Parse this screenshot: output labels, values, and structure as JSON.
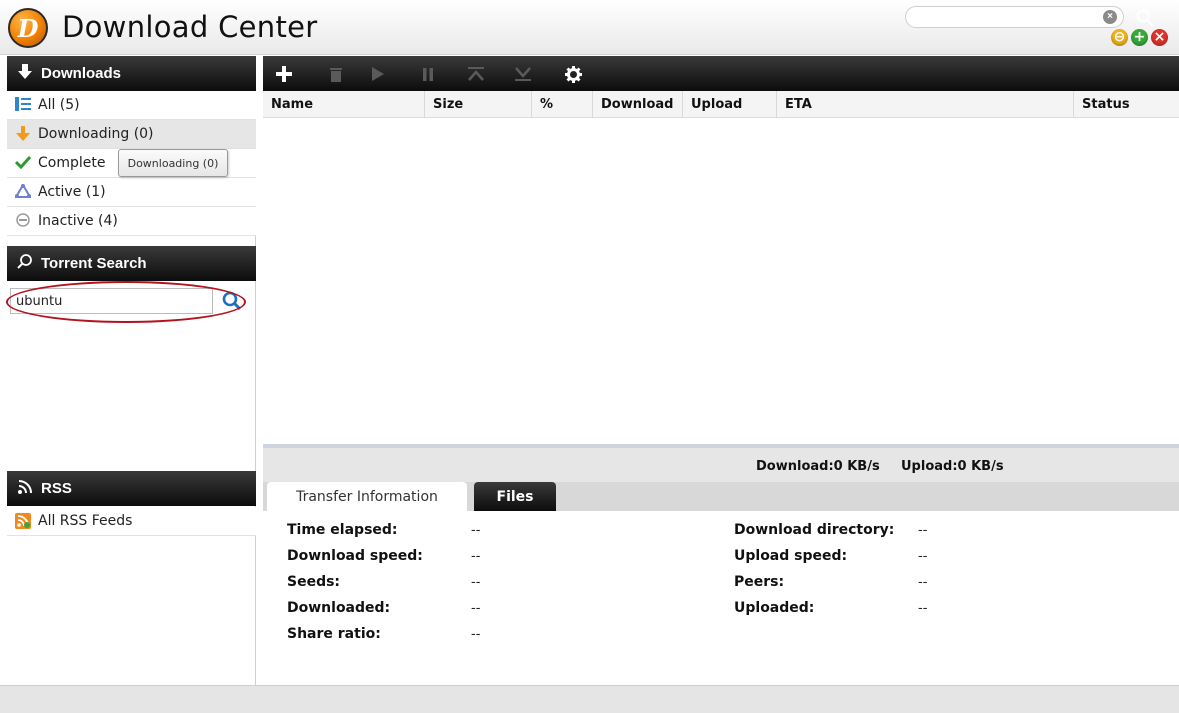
{
  "app": {
    "logo_letter": "D",
    "title": "Download Center"
  },
  "window_controls": {
    "minimize": "⊖",
    "maximize": "+",
    "close": "×"
  },
  "sidebar": {
    "downloads_header": "Downloads",
    "filters": [
      {
        "label": "All (5)",
        "icon": "list-icon"
      },
      {
        "label": "Downloading (0)",
        "icon": "download-arrow-icon"
      },
      {
        "label": "Complete",
        "icon": "checkmark-icon"
      },
      {
        "label": "Active (1)",
        "icon": "active-icon"
      },
      {
        "label": "Inactive (4)",
        "icon": "inactive-icon"
      }
    ],
    "tooltip": "Downloading (0)",
    "search_header": "Torrent Search",
    "search_value": "ubuntu",
    "rss_header": "RSS",
    "rss_items": [
      {
        "label": "All RSS Feeds",
        "icon": "rss-feed-icon"
      }
    ]
  },
  "toolbar": {
    "buttons": [
      "add",
      "delete",
      "start",
      "pause",
      "move-up",
      "move-down",
      "settings"
    ],
    "search_value": ""
  },
  "list": {
    "columns": [
      "Name",
      "Size",
      "%",
      "Download",
      "Upload",
      "ETA",
      "Status"
    ]
  },
  "stats": {
    "download": "Download:0 KB/s",
    "upload": "Upload:0 KB/s"
  },
  "tabs": {
    "transfer": "Transfer Information",
    "files": "Files"
  },
  "transfer_info": {
    "left": [
      {
        "label": "Time elapsed:",
        "value": "--"
      },
      {
        "label": "Download speed:",
        "value": "--"
      },
      {
        "label": "Seeds:",
        "value": "--"
      },
      {
        "label": "Downloaded:",
        "value": "--"
      },
      {
        "label": "Share ratio:",
        "value": "--"
      }
    ],
    "right": [
      {
        "label": "Download directory:",
        "value": "--"
      },
      {
        "label": "Upload speed:",
        "value": "--"
      },
      {
        "label": "Peers:",
        "value": "--"
      },
      {
        "label": "Uploaded:",
        "value": "--"
      }
    ]
  },
  "colors": {
    "header_dark": "#0c0c0c",
    "highlight_ring": "#b3131d",
    "min_button": "#f2b21d",
    "max_button": "#38a93a",
    "close_button": "#e0322b"
  }
}
